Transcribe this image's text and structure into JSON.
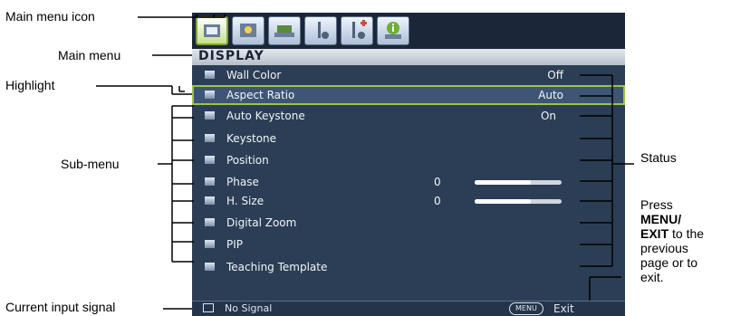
{
  "callouts": {
    "main_menu_icon": "Main menu icon",
    "main_menu": "Main menu",
    "highlight": "Highlight",
    "sub_menu": "Sub-menu",
    "current_input_signal": "Current input signal",
    "status": "Status",
    "press_line1": "Press",
    "press_bold1": "MENU/",
    "press_bold2": "EXIT",
    "press_rest1": " to the",
    "press_line4": "previous",
    "press_line5": "page or to",
    "press_line6": "exit."
  },
  "osd": {
    "title": "DISPLAY",
    "tabs": [
      {
        "icon": "display-icon",
        "active": true
      },
      {
        "icon": "picture-icon",
        "active": false
      },
      {
        "icon": "source-icon",
        "active": false
      },
      {
        "icon": "settings-basic-icon",
        "active": false
      },
      {
        "icon": "settings-advanced-icon",
        "active": false
      },
      {
        "icon": "information-icon",
        "active": false
      }
    ],
    "rows": [
      {
        "label": "Wall Color",
        "status": "Off",
        "highlighted": false
      },
      {
        "label": "Aspect Ratio",
        "status": "Auto",
        "highlighted": true
      },
      {
        "label": "Auto Keystone",
        "status": "On",
        "highlighted": false
      },
      {
        "label": "Keystone",
        "status": "",
        "highlighted": false
      },
      {
        "label": "Position",
        "status": "",
        "highlighted": false
      },
      {
        "label": "Phase",
        "value": "0",
        "slider_level": 0.65,
        "highlighted": false
      },
      {
        "label": "H. Size",
        "value": "0",
        "slider_level": 0.65,
        "highlighted": false
      },
      {
        "label": "Digital Zoom",
        "status": "",
        "highlighted": false
      },
      {
        "label": "PIP",
        "status": "",
        "highlighted": false
      },
      {
        "label": "Teaching Template",
        "status": "",
        "highlighted": false
      }
    ],
    "bottom": {
      "signal": "No Signal",
      "menu_button": "MENU",
      "exit": "Exit"
    }
  },
  "colors": {
    "panel": "#2c3e55",
    "highlight_border": "#9ac53f"
  }
}
